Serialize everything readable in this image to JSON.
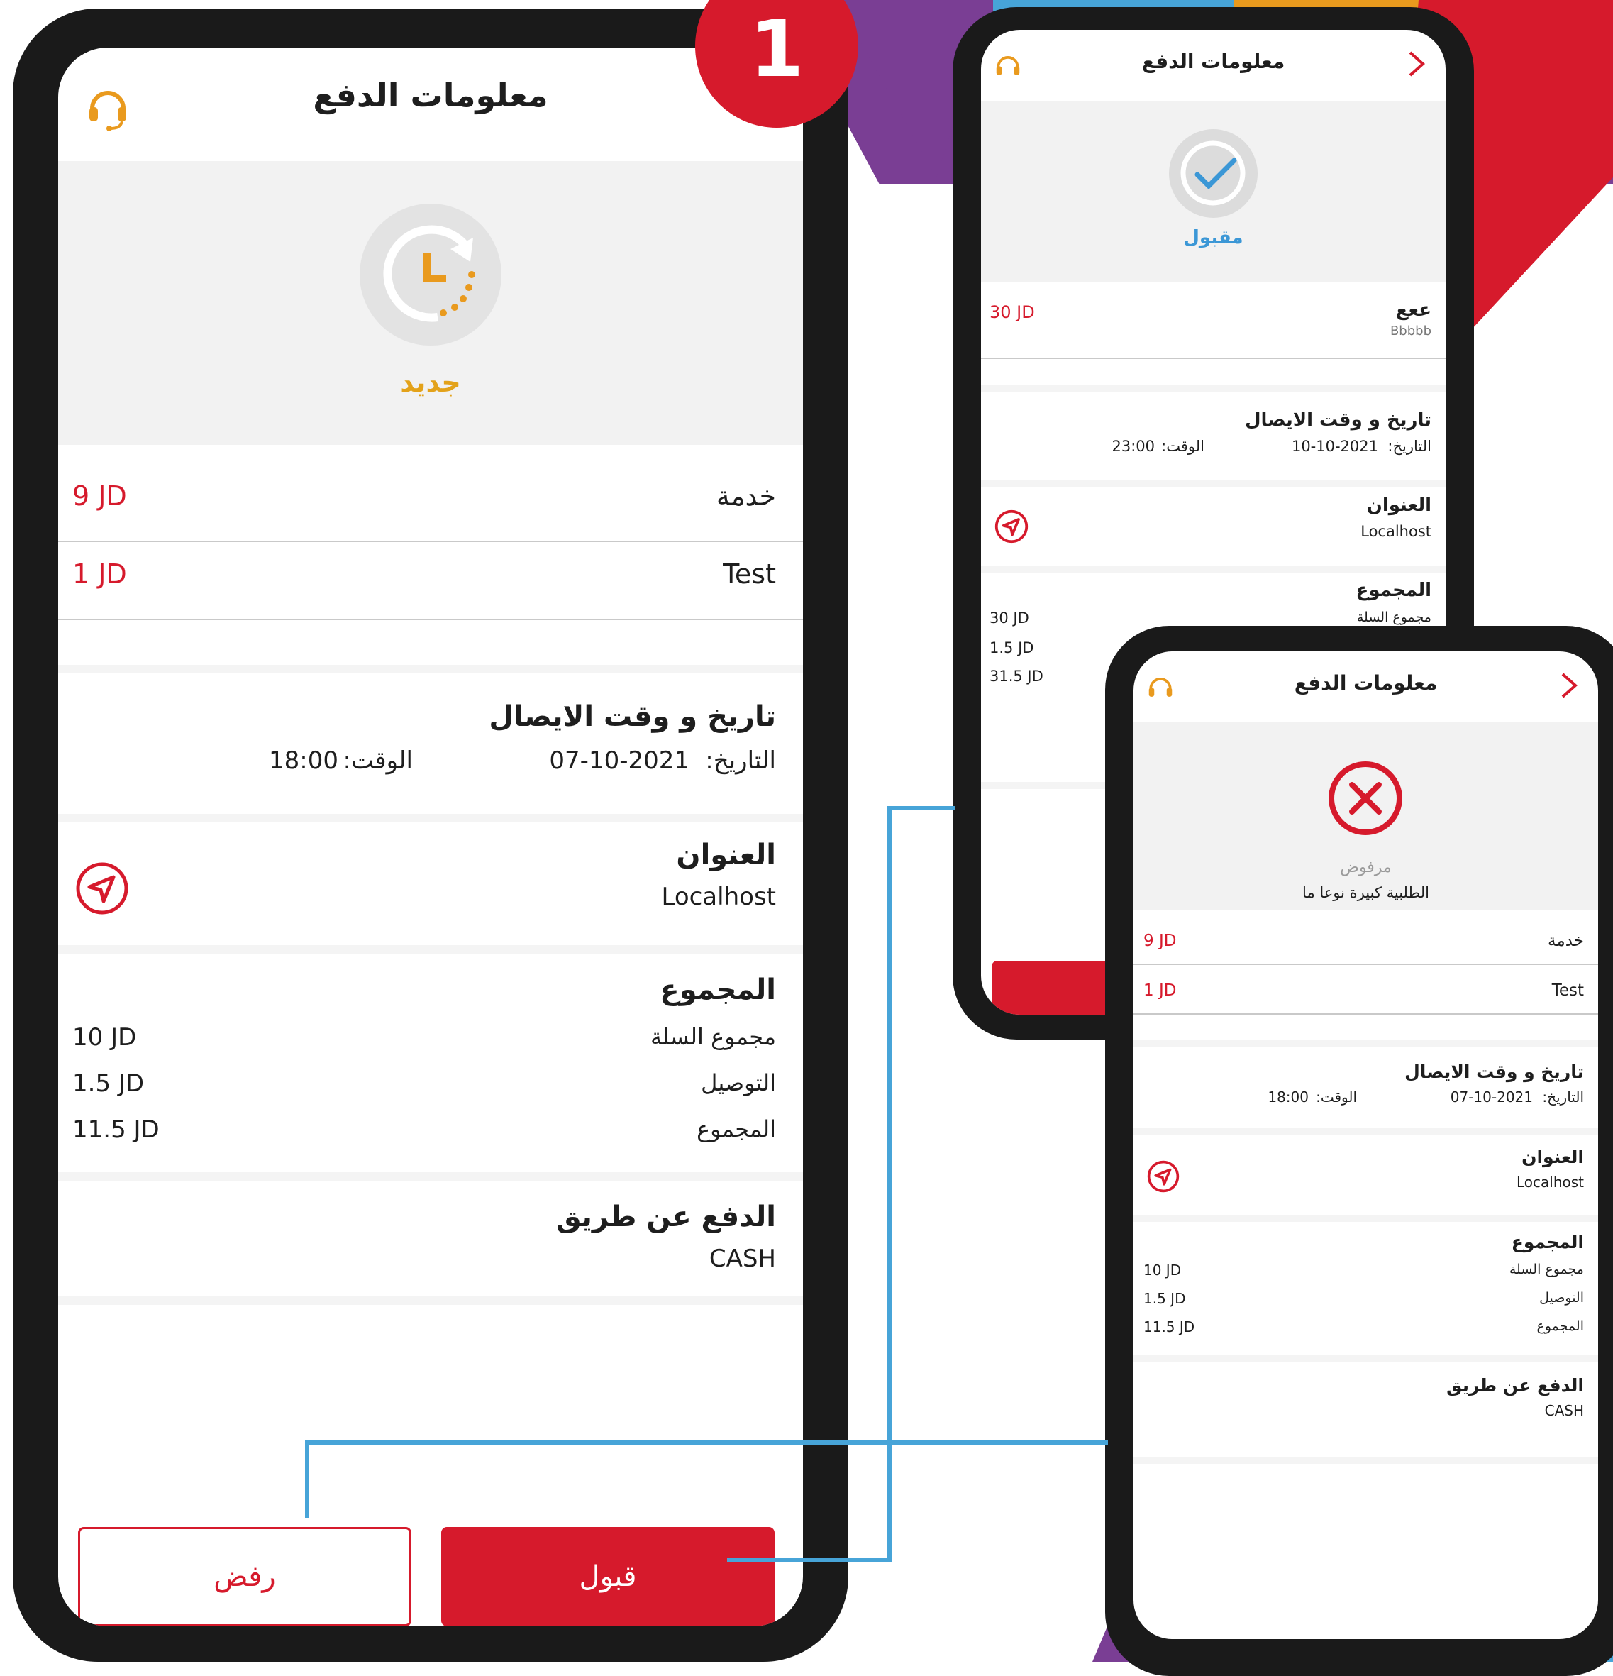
{
  "colors": {
    "brand_red": "#d61a2c",
    "purple": "#7a3e94",
    "blue_accent": "#47a4d8",
    "orange": "#e99a1e",
    "new_status": "#e3a21a",
    "accepted_status": "#3b97d6"
  },
  "badge": {
    "number": "1"
  },
  "main": {
    "title": "معلومات الدفع",
    "support_icon": "headset-icon",
    "status_icon": "clock-refresh-icon",
    "status_label": "جديد",
    "items": [
      {
        "name": "خدمة",
        "price": "9 JD"
      },
      {
        "name": "Test",
        "price": "1 JD"
      }
    ],
    "delivery": {
      "heading": "تاريخ و وقت الايصال",
      "date_label": "التاريخ:",
      "date": "07-10-2021",
      "time_label": "الوقت:",
      "time": "18:00"
    },
    "address": {
      "heading": "العنوان",
      "value": "Localhost",
      "icon": "navigation-icon"
    },
    "totals": {
      "heading": "المجموع",
      "rows": [
        {
          "label": "مجموع السلة",
          "value": "10 JD"
        },
        {
          "label": "التوصيل",
          "value": "1.5 JD"
        },
        {
          "label": "المجموع",
          "value": "11.5 JD"
        }
      ]
    },
    "payment": {
      "heading": "الدفع عن طريق",
      "value": "CASH"
    },
    "accept_label": "قبول",
    "reject_label": "رفض"
  },
  "accepted": {
    "title": "معلومات الدفع",
    "status_label": "مقبول",
    "item": {
      "name": "ععع",
      "sub": "Bbbbb",
      "price": "30 JD"
    },
    "delivery": {
      "heading": "تاريخ و وقت الايصال",
      "date_label": "التاريخ:",
      "date": "10-10-2021",
      "time_label": "الوقت:",
      "time": "23:00"
    },
    "address": {
      "heading": "العنوان",
      "value": "Localhost"
    },
    "totals": {
      "heading": "المجموع",
      "first_label": "مجموع السلة",
      "values": [
        "30 JD",
        "1.5 JD",
        "31.5 JD"
      ]
    }
  },
  "rejected": {
    "title": "معلومات الدفع",
    "status_label": "مرفوض",
    "reason": "الطلبية كبيرة نوعا ما",
    "items": [
      {
        "name": "خدمة",
        "price": "9 JD"
      },
      {
        "name": "Test",
        "price": "1 JD"
      }
    ],
    "delivery": {
      "heading": "تاريخ و وقت الايصال",
      "date_label": "التاريخ:",
      "date": "07-10-2021",
      "time_label": "الوقت:",
      "time": "18:00"
    },
    "address": {
      "heading": "العنوان",
      "value": "Localhost"
    },
    "totals": {
      "heading": "المجموع",
      "rows": [
        {
          "label": "مجموع السلة",
          "value": "10 JD"
        },
        {
          "label": "التوصيل",
          "value": "1.5 JD"
        },
        {
          "label": "المجموع",
          "value": "11.5 JD"
        }
      ]
    },
    "payment": {
      "heading": "الدفع عن طريق",
      "value": "CASH"
    }
  }
}
